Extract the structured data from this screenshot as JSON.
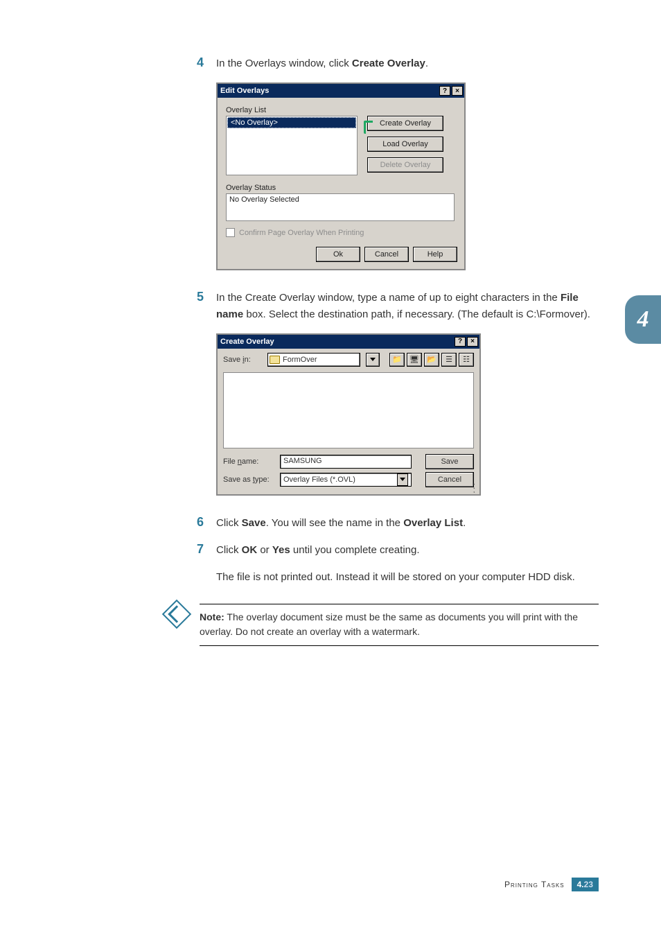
{
  "step4": {
    "num": "4",
    "pre": "In the Overlays window, click ",
    "bold": "Create Overlay",
    "post": "."
  },
  "editDialog": {
    "title": "Edit Overlays",
    "help": "?",
    "close": "×",
    "overlayListLabel": "Overlay List",
    "listItem": "<No Overlay>",
    "btnCreate": "Create Overlay",
    "btnLoad": "Load Overlay",
    "btnDelete": "Delete Overlay",
    "statusLabel": "Overlay Status",
    "statusText": "No Overlay Selected",
    "confirmLabel": "Confirm Page Overlay When Printing",
    "ok": "Ok",
    "cancel": "Cancel",
    "helpBtn": "Help"
  },
  "step5": {
    "num": "5",
    "pre": "In the Create Overlay window, type a name of up to eight characters in the ",
    "bold": "File name",
    "post": " box. Select the destination path, if necessary. (The default is C:\\Formover)."
  },
  "createDialog": {
    "title": "Create Overlay",
    "help": "?",
    "close": "×",
    "saveInLabel": "Save in:",
    "saveInLabelUL": "i",
    "saveInValue": "FormOver",
    "fileNameLabel": "File name:",
    "fileNameLabelUL": "n",
    "fileNameValue": "SAMSUNG",
    "saveTypeLabel": "Save as type:",
    "saveTypeLabelUL": "t",
    "saveTypeValue": "Overlay Files (*.OVL)",
    "save": "Save",
    "saveUL": "S",
    "cancel": "Cancel"
  },
  "step6": {
    "num": "6",
    "pre": "Click ",
    "b1": "Save",
    "mid": ". You will see the name in the ",
    "b2": "Overlay List",
    "post": "."
  },
  "step7": {
    "num": "7",
    "pre": "Click ",
    "b1": "OK",
    "mid": " or ",
    "b2": "Yes",
    "post": " until you complete creating."
  },
  "step7b": "The file is not printed out. Instead it will be stored on your computer HDD disk.",
  "note": {
    "label": "Note:",
    "text": " The overlay document size must be the same as documents you will print with the overlay. Do not create an overlay with a watermark."
  },
  "tab": "4",
  "footer": {
    "label": "Printing Tasks",
    "chapter": "4.",
    "page": "23"
  }
}
